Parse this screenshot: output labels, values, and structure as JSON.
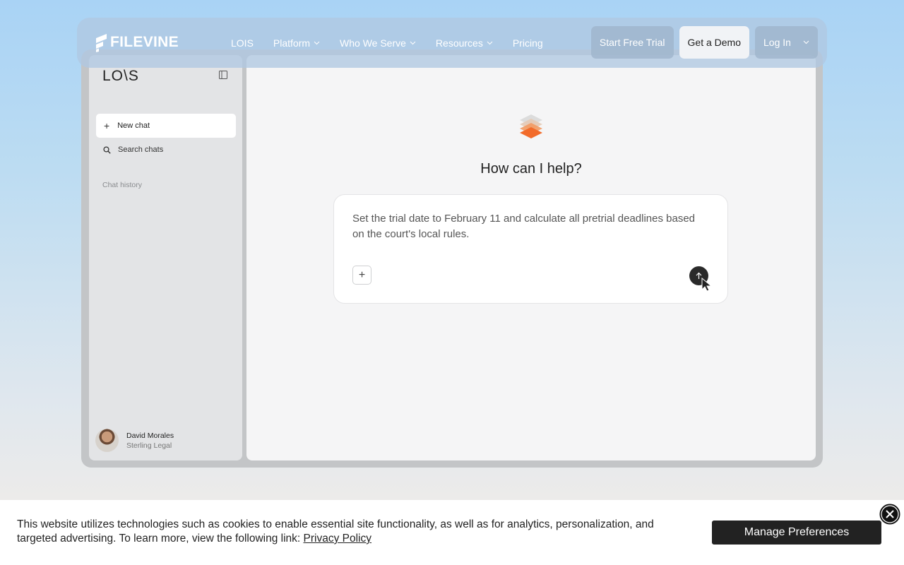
{
  "nav": {
    "brand": "FILEVINE",
    "links": [
      {
        "label": "LOIS",
        "dropdown": false
      },
      {
        "label": "Platform",
        "dropdown": true
      },
      {
        "label": "Who We Serve",
        "dropdown": true
      },
      {
        "label": "Resources",
        "dropdown": true
      },
      {
        "label": "Pricing",
        "dropdown": false
      }
    ],
    "trial_label": "Start Free Trial",
    "demo_label": "Get a Demo",
    "login_label": "Log In"
  },
  "sidebar": {
    "logo": "LO\\S",
    "new_chat": "New chat",
    "search_chats": "Search chats",
    "chat_history": "Chat history",
    "user": {
      "name": "David Morales",
      "org": "Sterling Legal"
    }
  },
  "main": {
    "title": "How can I help?",
    "prompt": "Set the trial date to February 11 and calculate all pretrial deadlines based on the court's local rules."
  },
  "cookie": {
    "text": "This website utilizes technologies such as cookies to enable essential site functionality, as well as for analytics, personalization, and targeted advertising. To learn more, view the following link:",
    "link_label": "Privacy Policy",
    "manage_label": "Manage Preferences"
  },
  "colors": {
    "accent_orange": "#f26b2a",
    "dark_button": "#222222"
  }
}
